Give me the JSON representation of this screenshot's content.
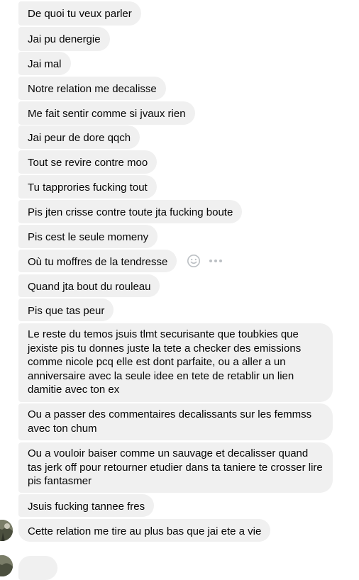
{
  "thread": {
    "messages": [
      "De quoi tu veux parler",
      "Jai pu denergie",
      "Jai mal",
      "Notre relation me decalisse",
      "Me fait sentir comme si jvaux rien",
      "Jai peur de dore qqch",
      "Tout se revire contre moo",
      "Tu tapprories fucking tout",
      "Pis jten crisse contre toute jta fucking boute",
      "Pis cest le seule momeny",
      "Où tu moffres de la tendresse",
      "Quand jta bout du rouleau",
      "Pis que tas peur",
      "Le reste du temos jsuis tlmt securisante que toubkies que jexiste pis tu donnes juste la tete a checker des emissions comme nicole pcq elle est dont parfaite, ou a aller a un anniversaire avec la seule idee en tete de retablir un lien damitie avec ton ex",
      "Ou a passer des commentaires decalissants sur les femmss avec ton chum",
      "Ou a vouloir baiser comme un sauvage et decalisser quand tas jerk off pour retourner etudier dans ta taniere te crosser lire pis fantasmer",
      "Jsuis fucking tannee fres",
      "Cette relation me tire au plus bas que jai ete a vie"
    ]
  },
  "hover_actions": {
    "react_icon": "smiley-icon",
    "more_icon": "more-dots-icon"
  },
  "colors": {
    "bubble_bg": "#f0f0f0",
    "text": "#050505",
    "icon": "#bcc0c4"
  }
}
